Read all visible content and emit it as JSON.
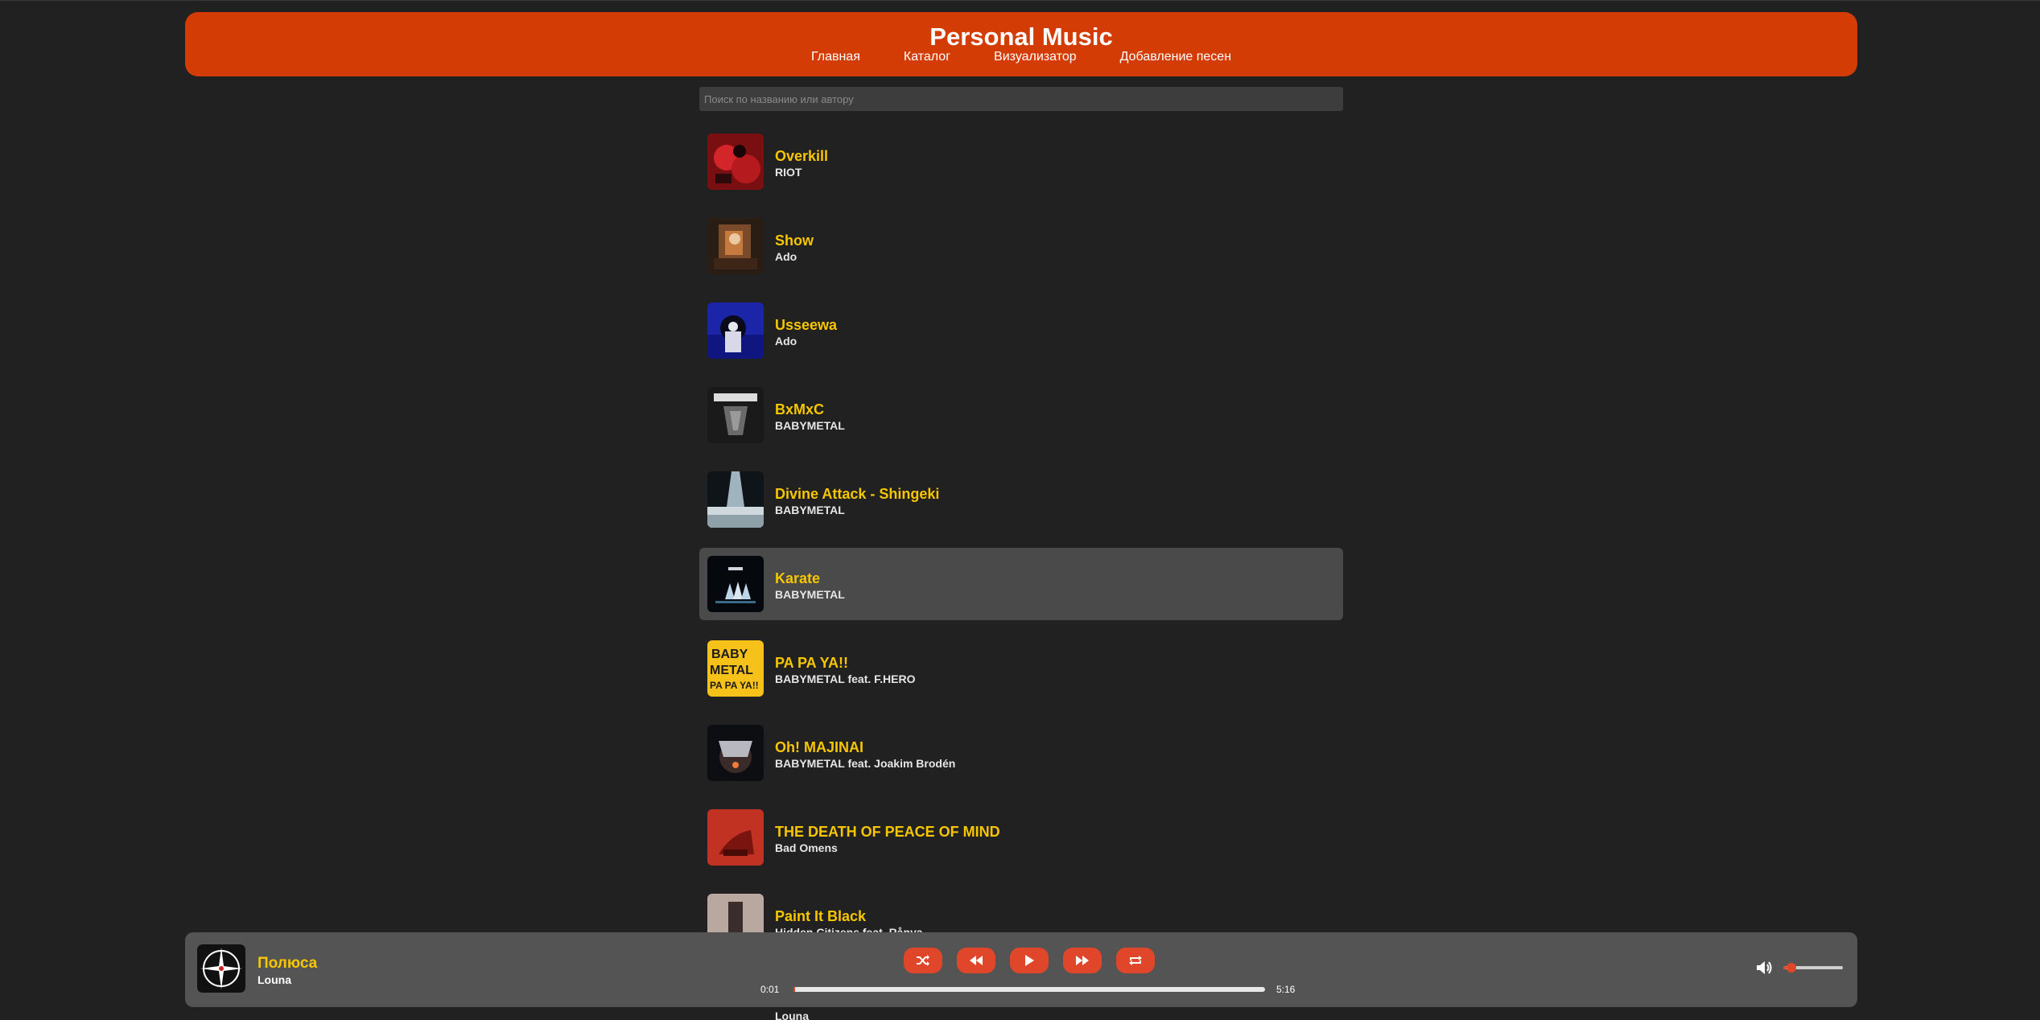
{
  "header": {
    "title": "Personal Music",
    "nav": [
      "Главная",
      "Каталог",
      "Визуализатор",
      "Добавление песен"
    ]
  },
  "search": {
    "placeholder": "Поиск по названию или автору",
    "value": ""
  },
  "songs": [
    {
      "title": "Overkill",
      "artist": "RIOT",
      "active": false
    },
    {
      "title": "Show",
      "artist": "Ado",
      "active": false
    },
    {
      "title": "Usseewa",
      "artist": "Ado",
      "active": false
    },
    {
      "title": "BxMxC",
      "artist": "BABYMETAL",
      "active": false
    },
    {
      "title": "Divine Attack - Shingeki",
      "artist": "BABYMETAL",
      "active": false
    },
    {
      "title": "Karate",
      "artist": "BABYMETAL",
      "active": true
    },
    {
      "title": "PA PA YA!!",
      "artist": "BABYMETAL feat. F.HERO",
      "active": false
    },
    {
      "title": "Oh! MAJINAI",
      "artist": "BABYMETAL feat. Joakim Brodén",
      "active": false
    },
    {
      "title": "THE DEATH OF PEACE OF MIND",
      "artist": "Bad Omens",
      "active": false
    },
    {
      "title": "Paint It Black",
      "artist": "Hidden Citizens feat. Rånya",
      "active": false
    }
  ],
  "next_song_artist": "Louna",
  "player": {
    "title": "Полюса",
    "artist": "Louna",
    "current_time": "0:01",
    "total_time": "5:16",
    "progress": 0.003,
    "volume": 0.05,
    "controls": [
      "shuffle-icon",
      "rewind-icon",
      "play-icon",
      "fast-forward-icon",
      "repeat-icon"
    ]
  },
  "colors": {
    "background": "#212121",
    "header": "#d33d05",
    "accent": "#e0462a",
    "title_yellow": "#f7c600",
    "player_bg": "#545454",
    "active_row": "#4a4a4a"
  }
}
